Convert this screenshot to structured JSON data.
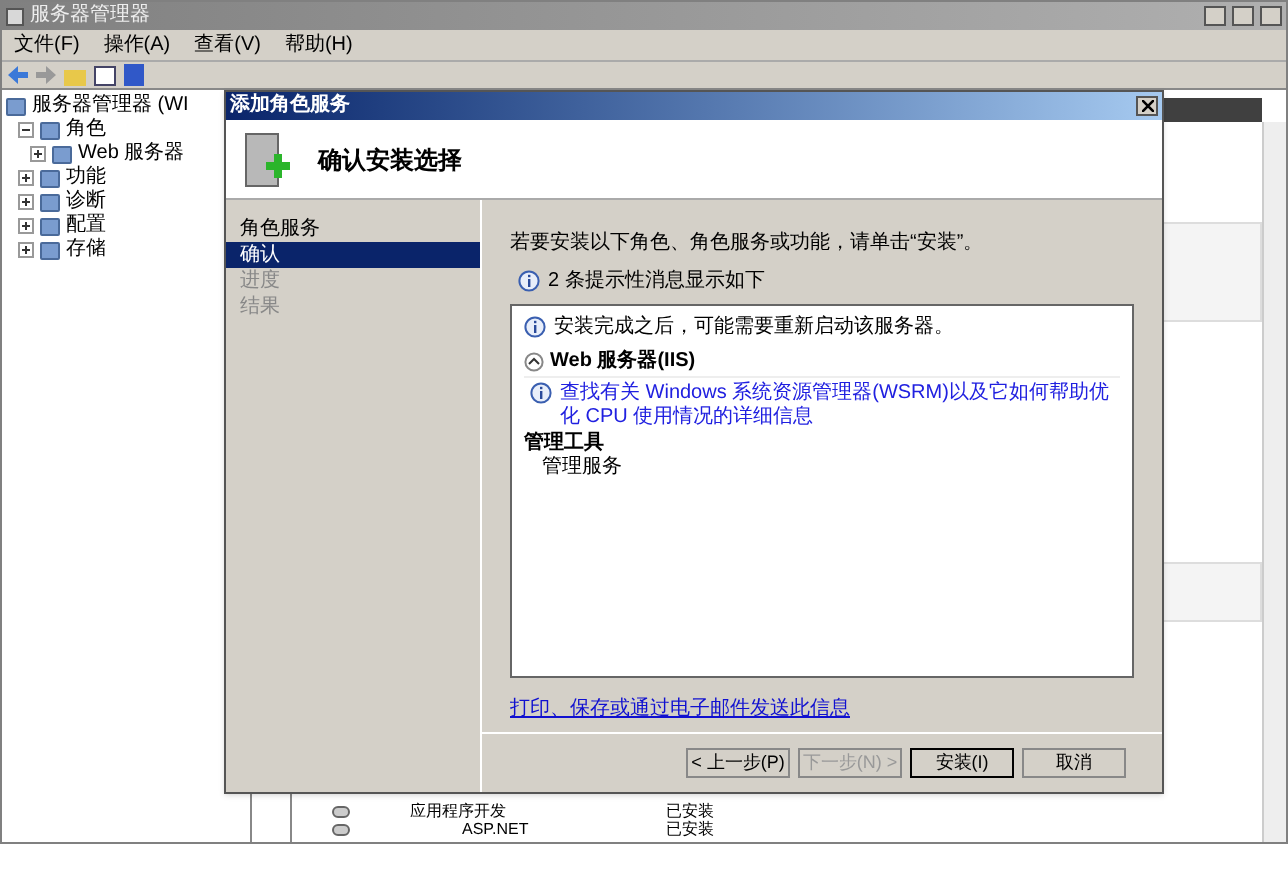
{
  "window": {
    "title": "服务器管理器"
  },
  "menu": [
    {
      "label": "文件(F)"
    },
    {
      "label": "操作(A)"
    },
    {
      "label": "查看(V)"
    },
    {
      "label": "帮助(H)"
    }
  ],
  "tree": [
    {
      "label": "服务器管理器 (WI",
      "children": [
        {
          "label": "角色",
          "expanded": true,
          "children": [
            {
              "label": "Web 服务器",
              "expanded": false
            }
          ]
        },
        {
          "label": "功能",
          "expanded": false
        },
        {
          "label": "诊断",
          "expanded": false
        },
        {
          "label": "配置",
          "expanded": false
        },
        {
          "label": "存储",
          "expanded": false
        }
      ]
    }
  ],
  "background_rows": [
    {
      "name": "应用程序开发",
      "status": "已安装",
      "children": [
        {
          "name": "ASP.NET",
          "status": "已安装"
        }
      ]
    }
  ],
  "dialog": {
    "title": "添加角色服务",
    "heading": "确认安装选择",
    "steps": [
      {
        "label": "角色服务",
        "selected": false,
        "disabled": false
      },
      {
        "label": "确认",
        "selected": true,
        "disabled": false
      },
      {
        "label": "进度",
        "selected": false,
        "disabled": true
      },
      {
        "label": "结果",
        "selected": false,
        "disabled": true
      }
    ],
    "intro": "若要安装以下角色、角色服务或功能，请单击“安装”。",
    "notice": "2 条提示性消息显示如下",
    "details": [
      {
        "kind": "info",
        "text": "安装完成之后，可能需要重新启动该服务器。"
      },
      {
        "kind": "section",
        "text": "Web 服务器(IIS)"
      },
      {
        "kind": "link",
        "text": "查找有关 Windows 系统资源管理器(WSRM)以及它如何帮助优化 CPU 使用情况的详细信息"
      },
      {
        "kind": "group",
        "text": "管理工具"
      },
      {
        "kind": "item",
        "text": "管理服务"
      }
    ],
    "export_link": "打印、保存或通过电子邮件发送此信息",
    "buttons": [
      {
        "label": "< 上一步(P)",
        "disabled": false,
        "default": false
      },
      {
        "label": "下一步(N) >",
        "disabled": true,
        "default": false
      },
      {
        "label": "安装(I)",
        "disabled": false,
        "default": true
      },
      {
        "label": "取消",
        "disabled": false,
        "default": false
      }
    ]
  }
}
